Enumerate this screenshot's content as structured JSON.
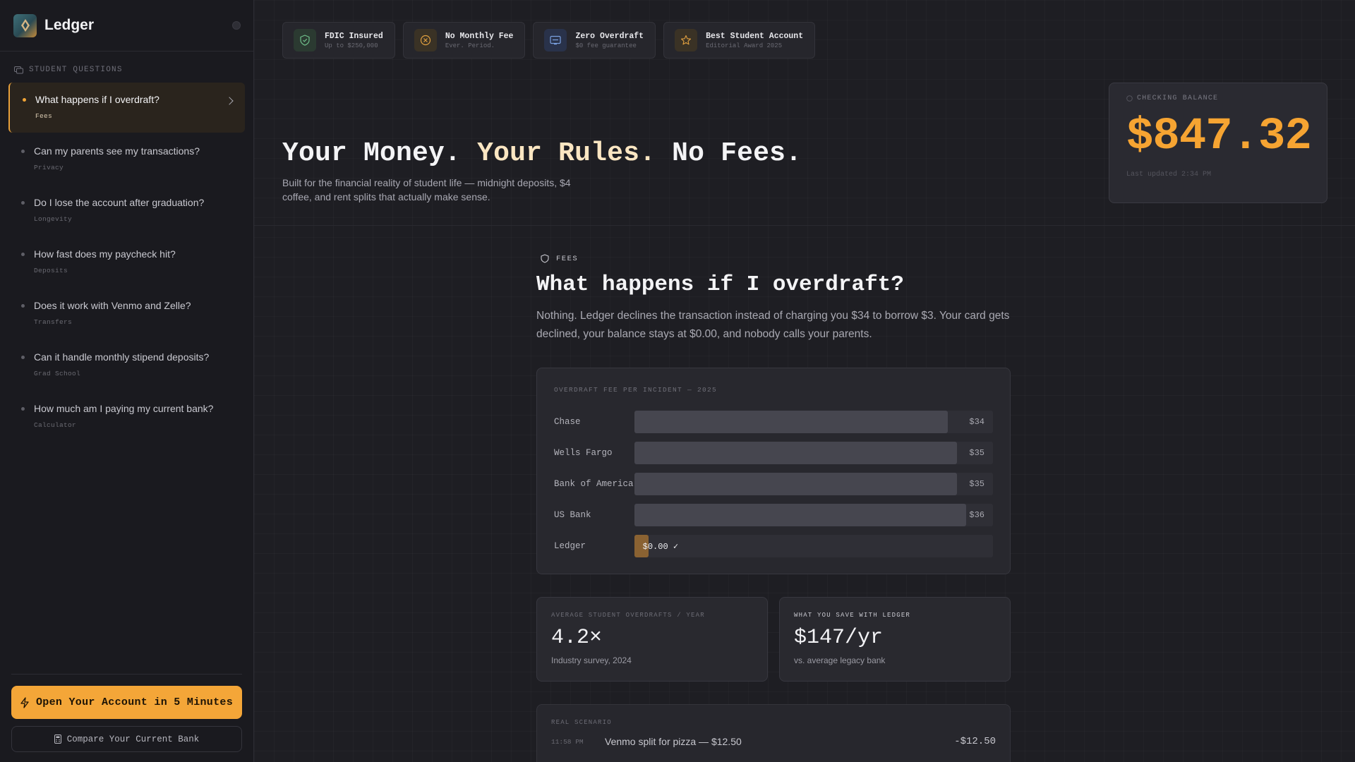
{
  "sidebar": {
    "brand": "Ledger",
    "section_label": "STUDENT QUESTIONS",
    "items": [
      {
        "title": "What happens if I overdraft?",
        "tag": "Fees"
      },
      {
        "title": "Can my parents see my transactions?",
        "tag": "Privacy"
      },
      {
        "title": "Do I lose the account after graduation?",
        "tag": "Longevity"
      },
      {
        "title": "How fast does my paycheck hit?",
        "tag": "Deposits"
      },
      {
        "title": "Does it work with Venmo and Zelle?",
        "tag": "Transfers"
      },
      {
        "title": "Can it handle monthly stipend deposits?",
        "tag": "Grad School"
      },
      {
        "title": "How much am I paying my current bank?",
        "tag": "Calculator"
      }
    ],
    "cta_label": "Open Your Account in 5 Minutes",
    "secondary_label": "Compare Your Current Bank"
  },
  "badges": [
    {
      "title": "FDIC Insured",
      "sub": "Up to $250,000",
      "icon": "shield-icon",
      "color": "#6fbf8a"
    },
    {
      "title": "No Monthly Fee",
      "sub": "Ever. Period.",
      "icon": "no-fee-icon",
      "color": "#e0a040"
    },
    {
      "title": "Zero Overdraft",
      "sub": "$0 fee guarantee",
      "icon": "card-icon",
      "color": "#7aa0e0"
    },
    {
      "title": "Best Student Account",
      "sub": "Editorial Award 2025",
      "icon": "star-icon",
      "color": "#e0a040"
    }
  ],
  "hero": {
    "title_a": "Your Money.",
    "title_b": "Your Rules.",
    "title_c": "No Fees.",
    "subtitle": "Built for the financial reality of student life — midnight deposits, $4 coffee, and rent splits that actually make sense."
  },
  "balance": {
    "label": "CHECKING BALANCE",
    "amount": "$847.32",
    "updated": "Last updated 2:34 PM"
  },
  "article": {
    "eyebrow": "FEES",
    "title": "What happens if I overdraft?",
    "body": "Nothing. Ledger declines the transaction instead of charging you $34 to borrow $3. Your card gets declined, your balance stays at $0.00, and nobody calls your parents."
  },
  "chart_data": {
    "type": "bar",
    "title": "OVERDRAFT FEE PER INCIDENT — 2025",
    "categories": [
      "Chase",
      "Wells Fargo",
      "Bank of America",
      "US Bank",
      "Ledger"
    ],
    "values": [
      34,
      35,
      35,
      36,
      0
    ],
    "value_labels": [
      "$34",
      "$35",
      "$35",
      "$36",
      "$0.00 ✓"
    ],
    "xlim": [
      0,
      36
    ],
    "colors": {
      "bar": "#46464f",
      "highlight": "#8a6232"
    }
  },
  "stats": [
    {
      "label": "AVERAGE STUDENT OVERDRAFTS / YEAR",
      "value": "4.2×",
      "note": "Industry survey, 2024"
    },
    {
      "label": "WHAT YOU SAVE WITH LEDGER",
      "value": "$147/yr",
      "note": "vs. average legacy bank"
    }
  ],
  "scenario": {
    "label": "REAL SCENARIO",
    "time": "11:58 PM",
    "description": "Venmo split for pizza — $12.50",
    "amount": "-$12.50"
  },
  "colors": {
    "accent": "#f4a638",
    "background": "#1e1e23"
  }
}
